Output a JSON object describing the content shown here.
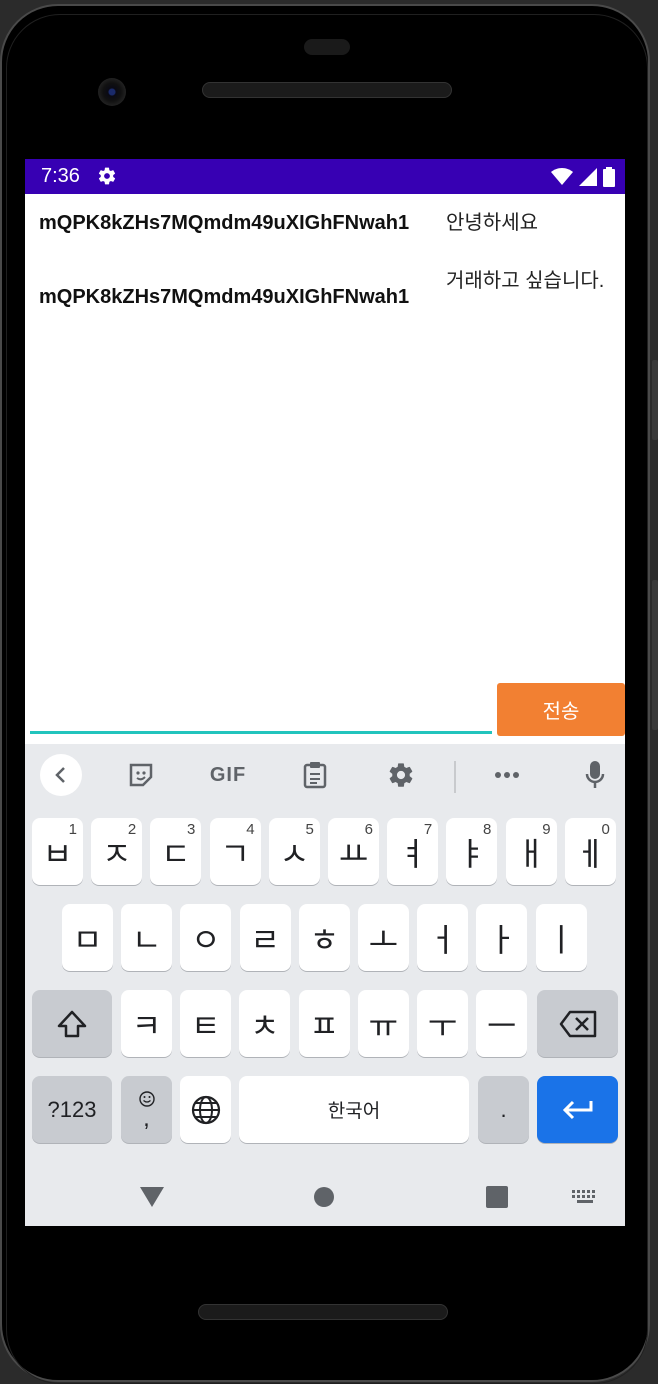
{
  "status_bar": {
    "time": "7:36",
    "background": "#3700b3"
  },
  "messages": [
    {
      "user": "mQPK8kZHs7MQmdm49uXIGhFNwah1",
      "text": "안녕하세요"
    },
    {
      "user": "mQPK8kZHs7MQmdm49uXIGhFNwah1",
      "text": "거래하고 싶습니다."
    }
  ],
  "composer": {
    "value": "",
    "send_label": "전송",
    "send_color": "#f28032",
    "underline_color": "#22c4bd"
  },
  "keyboard": {
    "toolbar": {
      "gif_label": "GIF"
    },
    "row1": [
      {
        "label": "ㅂ",
        "hint": "1"
      },
      {
        "label": "ㅈ",
        "hint": "2"
      },
      {
        "label": "ㄷ",
        "hint": "3"
      },
      {
        "label": "ㄱ",
        "hint": "4"
      },
      {
        "label": "ㅅ",
        "hint": "5"
      },
      {
        "label": "ㅛ",
        "hint": "6"
      },
      {
        "label": "ㅕ",
        "hint": "7"
      },
      {
        "label": "ㅑ",
        "hint": "8"
      },
      {
        "label": "ㅐ",
        "hint": "9"
      },
      {
        "label": "ㅔ",
        "hint": "0"
      }
    ],
    "row2": [
      "ㅁ",
      "ㄴ",
      "ㅇ",
      "ㄹ",
      "ㅎ",
      "ㅗ",
      "ㅓ",
      "ㅏ",
      "ㅣ"
    ],
    "row3": [
      "ㅋ",
      "ㅌ",
      "ㅊ",
      "ㅍ",
      "ㅠ",
      "ㅜ",
      "ㅡ"
    ],
    "symbols_label": "?123",
    "emoji_comma_label": ",",
    "space_label": "한국어",
    "period_label": ".",
    "enter_color": "#1a73e8"
  }
}
